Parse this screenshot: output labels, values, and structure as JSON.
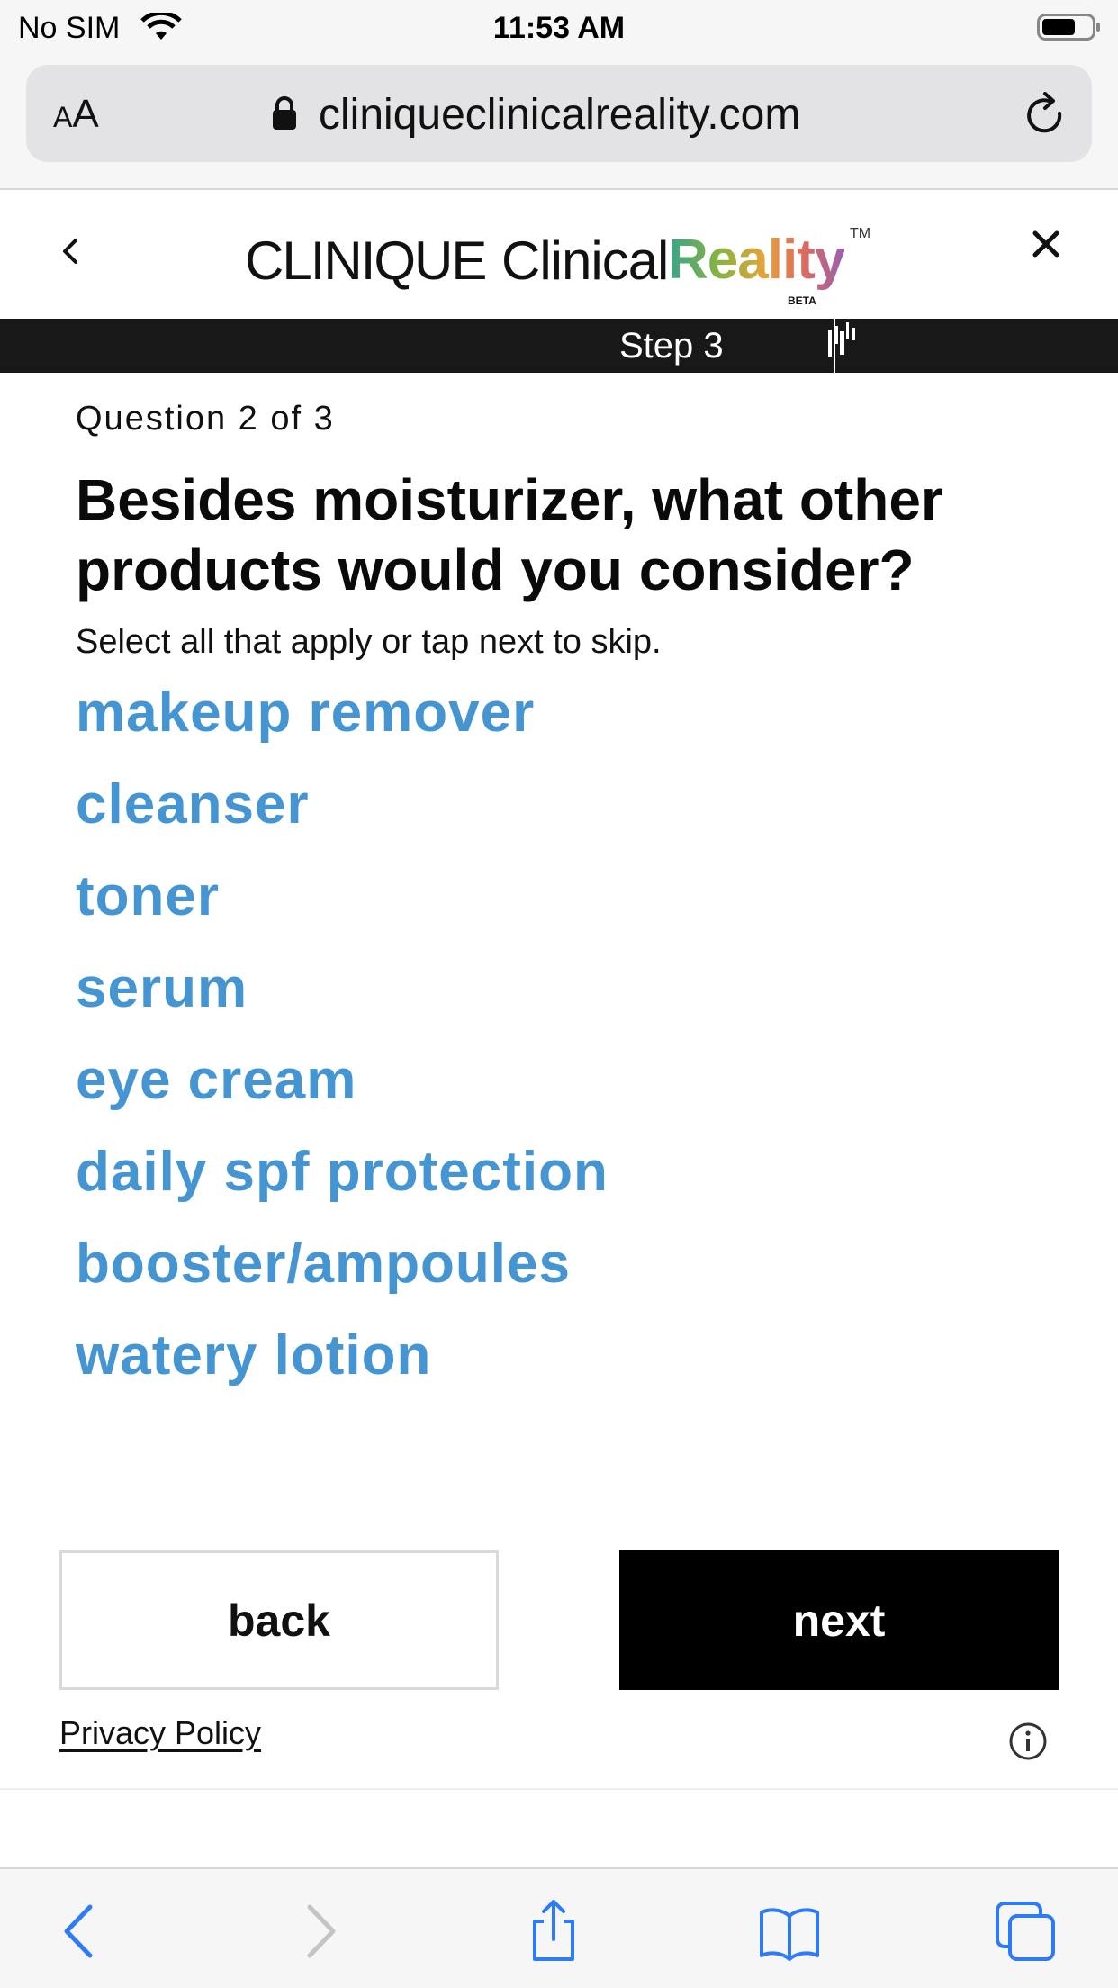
{
  "status_bar": {
    "carrier": "No SIM",
    "time": "11:53 AM"
  },
  "browser": {
    "text_size_label_small": "A",
    "text_size_label_large": "A",
    "url": "cliniqueclinicalreality.com"
  },
  "header": {
    "logo_brand": "CLINIQUE",
    "logo_clinical": "Clinical",
    "logo_reality": "Reality",
    "logo_tm": "TM",
    "logo_beta": "BETA"
  },
  "step": {
    "label": "Step 3"
  },
  "question": {
    "count": "Question 2 of 3",
    "title": "Besides moisturizer, what other products would you consider?",
    "hint": "Select all that apply or tap next to skip."
  },
  "options": [
    {
      "label": "makeup remover"
    },
    {
      "label": "cleanser"
    },
    {
      "label": "toner"
    },
    {
      "label": "serum"
    },
    {
      "label": "eye cream"
    },
    {
      "label": "daily spf protection"
    },
    {
      "label": "booster/ampoules"
    },
    {
      "label": "watery lotion"
    }
  ],
  "buttons": {
    "back": "back",
    "next": "next"
  },
  "footer": {
    "privacy": "Privacy Policy"
  },
  "colors": {
    "option_blue": "#4495d2",
    "reality_gradient": [
      "#3aa38a",
      "#8bb33f",
      "#e7a23a",
      "#e06d5a",
      "#9a5fb0"
    ]
  }
}
